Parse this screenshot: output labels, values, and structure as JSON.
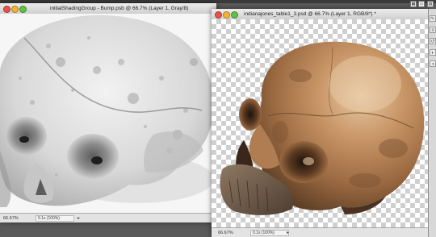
{
  "left_document": {
    "title": "initialShadingGroup - Bump.psb @ 66.7% (Layer 1, Gray/8)",
    "zoom": "66.67%",
    "doc_info": "0.1s (100%)",
    "image": "grayscale-skull-bump-map"
  },
  "right_document": {
    "title": "indianajones_table1_3.psd @ 66.7% (Layer 1, RGB/8*) *",
    "zoom": "66.67%",
    "doc_info": "0.1s (100%)",
    "image": "textured-skull-on-transparent-background"
  },
  "panel_strip": {
    "icons": [
      "brush-icon",
      "layers-icon",
      "history-icon",
      "channels-icon",
      "adjustments-icon"
    ]
  },
  "colors": {
    "background": "#5a5a5a",
    "titlebar": "#dcdcdc",
    "skull_color": "#b88457",
    "checker": "#cfcfcf"
  }
}
